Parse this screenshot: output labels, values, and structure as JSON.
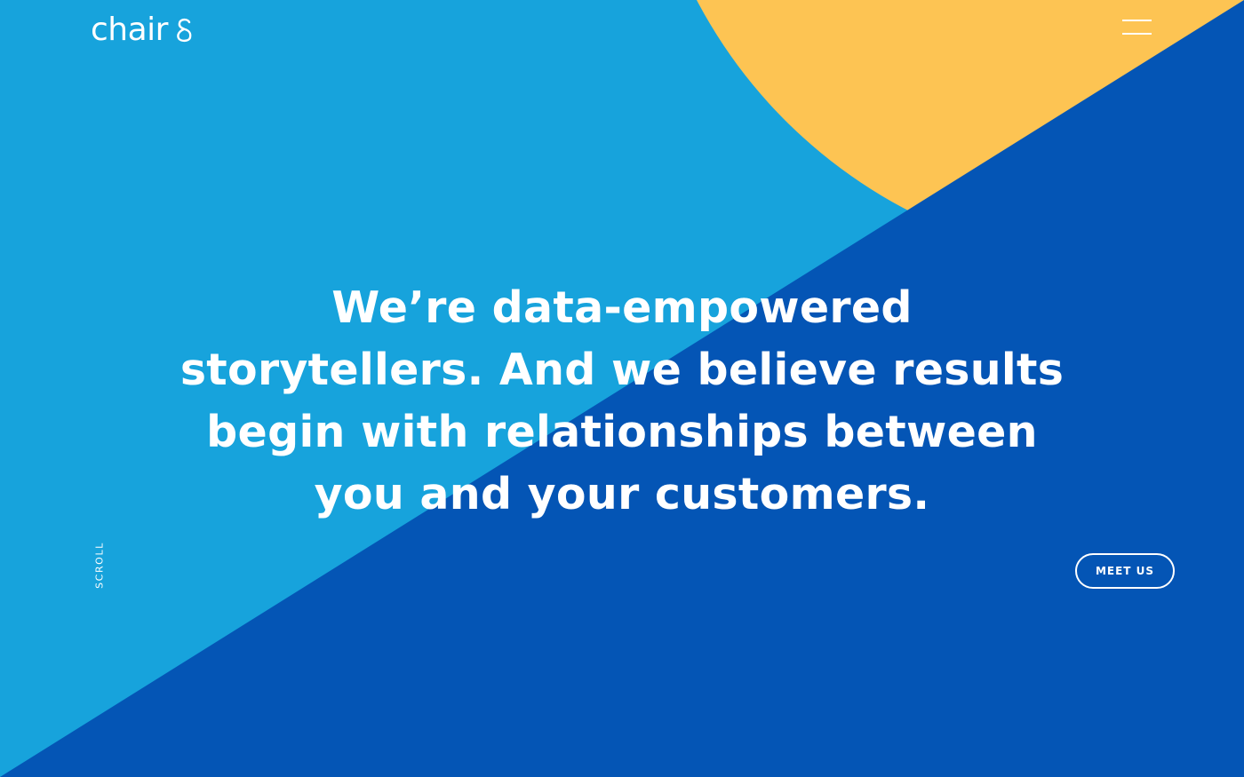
{
  "brand": {
    "name": "chair",
    "mark_icon": "ampersand-mark-icon"
  },
  "header": {
    "menu_icon": "hamburger-menu-icon"
  },
  "hero": {
    "headline_lines": [
      "We’re data-empowered",
      "storytellers. And we believe results",
      "begin with relationships between",
      "you and your customers."
    ],
    "scroll_label": "SCROLL",
    "cta_label": "MEET US"
  },
  "colors": {
    "light_blue": "#17a3dc",
    "dark_blue": "#0455b5",
    "yellow": "#fdc453",
    "text": "#ffffff"
  }
}
